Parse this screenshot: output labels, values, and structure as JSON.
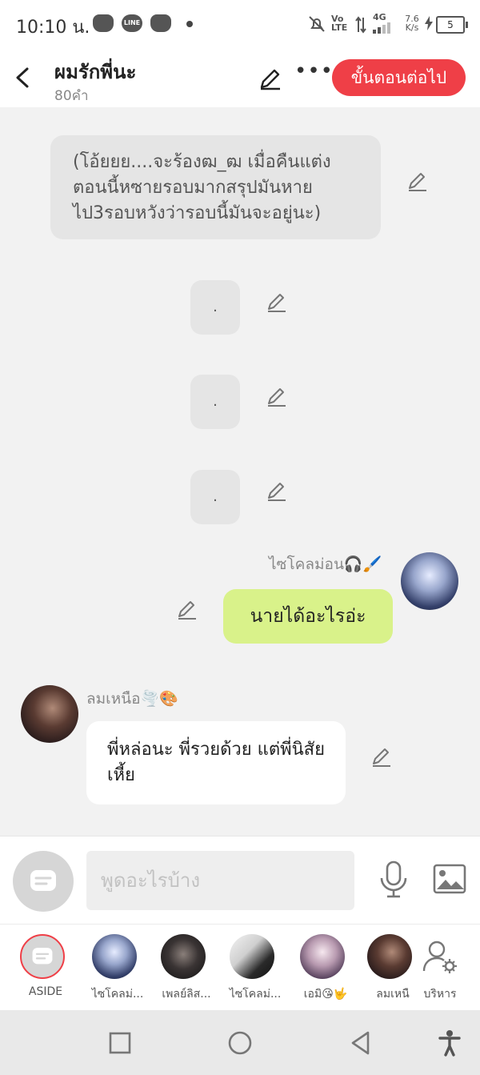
{
  "status_bar": {
    "time": "10:10 น.",
    "line_label": "LINE",
    "volte": "Vo LTE",
    "network": "4G",
    "speed": "7.6 K/s",
    "battery": "5"
  },
  "header": {
    "title": "ผมรักพี่นะ",
    "word_count": "80คำ",
    "next_button": "ขั้นตอนต่อไป"
  },
  "messages": {
    "narration": "(โอ้ยยย....จะร้องฒ_ฒ เมื่อคืนแต่งตอนนี้หซายรอบมากสรุปมันหายไป3รอบหวังว่ารอบนี้มันจะอยู่นะ)",
    "dot_1": ".",
    "dot_2": ".",
    "dot_3": ".",
    "right_name": "ไซโคลม่อน🎧🖌️",
    "right_text": "นายได้อะไรอ่ะ",
    "left_name": "ลมเหนือ🌪️🎨",
    "left_text": "พี่หล่อนะ พี่รวยด้วย แต่พี่นิสัยเหี้ย"
  },
  "composer": {
    "placeholder": "พูดอะไรบ้าง"
  },
  "characters": [
    {
      "label": "ASIDE"
    },
    {
      "label": "ไซโคลม่..."
    },
    {
      "label": "เพลย์ลิส..."
    },
    {
      "label": "ไซโคลม่..."
    },
    {
      "label": "เอมิ😘🤟"
    },
    {
      "label": "ลมเหนื"
    },
    {
      "label": "บริหาร"
    }
  ],
  "colors": {
    "accent": "#ef3f47",
    "user_bubble": "#d9f28a"
  }
}
